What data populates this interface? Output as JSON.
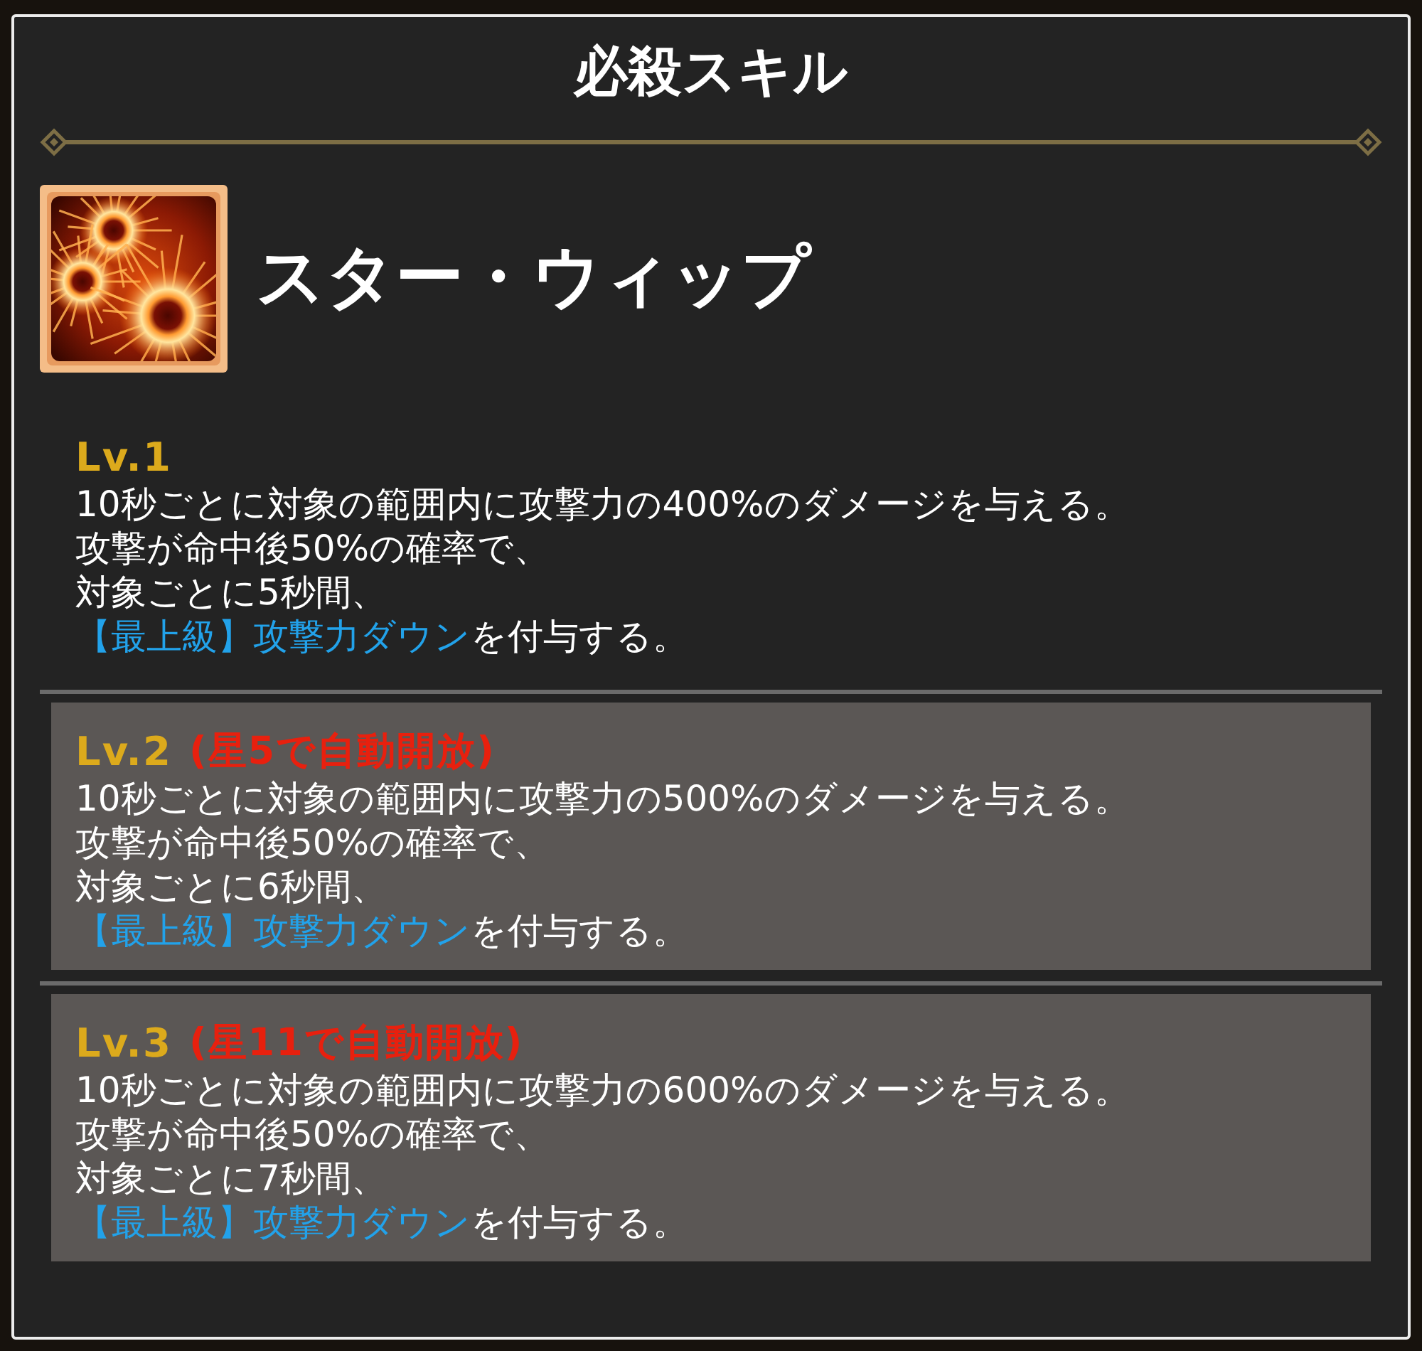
{
  "panel": {
    "title": "必殺スキル"
  },
  "skill": {
    "name": "スター・ウィップ"
  },
  "levels": [
    {
      "label": "Lv.1",
      "locked": false,
      "lines": [
        "10秒ごとに対象の範囲内に攻撃力の400%のダメージを与える。",
        "攻撃が命中後50%の確率で、",
        "対象ごとに5秒間、"
      ],
      "effect": {
        "keyword": "【最上級】攻撃力ダウン",
        "text": "を付与する。"
      }
    },
    {
      "label": "Lv.2",
      "unlock_condition": "(星5で自動開放)",
      "locked": true,
      "lines": [
        "10秒ごとに対象の範囲内に攻撃力の500%のダメージを与える。",
        "攻撃が命中後50%の確率で、",
        "対象ごとに6秒間、"
      ],
      "effect": {
        "keyword": "【最上級】攻撃力ダウン",
        "text": "を付与する。"
      }
    },
    {
      "label": "Lv.3",
      "unlock_condition": "(星11で自動開放)",
      "locked": true,
      "lines": [
        "10秒ごとに対象の範囲内に攻撃力の600%のダメージを与える。",
        "攻撃が命中後50%の確率で、",
        "対象ごとに7秒間、"
      ],
      "effect": {
        "keyword": "【最上級】攻撃力ダウン",
        "text": "を付与する。"
      }
    }
  ]
}
